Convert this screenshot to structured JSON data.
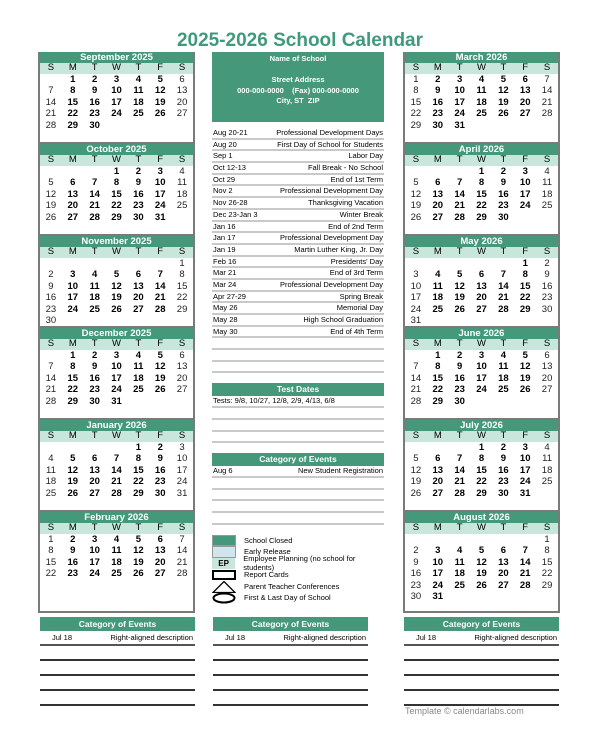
{
  "title": "2025-2026 School Calendar",
  "dow": [
    "S",
    "M",
    "T",
    "W",
    "T",
    "F",
    "S"
  ],
  "months_left": [
    {
      "name": "September 2025",
      "weeks": [
        [
          "",
          "1",
          "2",
          "3",
          "4",
          "5",
          "6"
        ],
        [
          "7",
          "8",
          "9",
          "10",
          "11",
          "12",
          "13"
        ],
        [
          "14",
          "15",
          "16",
          "17",
          "18",
          "19",
          "20"
        ],
        [
          "21",
          "22",
          "23",
          "24",
          "25",
          "26",
          "27"
        ],
        [
          "28",
          "29",
          "30",
          "",
          "",
          "",
          ""
        ]
      ]
    },
    {
      "name": "October 2025",
      "weeks": [
        [
          "",
          "",
          "",
          "1",
          "2",
          "3",
          "4"
        ],
        [
          "5",
          "6",
          "7",
          "8",
          "9",
          "10",
          "11"
        ],
        [
          "12",
          "13",
          "14",
          "15",
          "16",
          "17",
          "18"
        ],
        [
          "19",
          "20",
          "21",
          "22",
          "23",
          "24",
          "25"
        ],
        [
          "26",
          "27",
          "28",
          "29",
          "30",
          "31",
          ""
        ]
      ]
    },
    {
      "name": "November 2025",
      "weeks": [
        [
          "",
          "",
          "",
          "",
          "",
          "",
          "1"
        ],
        [
          "2",
          "3",
          "4",
          "5",
          "6",
          "7",
          "8"
        ],
        [
          "9",
          "10",
          "11",
          "12",
          "13",
          "14",
          "15"
        ],
        [
          "16",
          "17",
          "18",
          "19",
          "20",
          "21",
          "22"
        ],
        [
          "23",
          "24",
          "25",
          "26",
          "27",
          "28",
          "29"
        ],
        [
          "30",
          "",
          "",
          "",
          "",
          "",
          ""
        ]
      ]
    },
    {
      "name": "December 2025",
      "weeks": [
        [
          "",
          "1",
          "2",
          "3",
          "4",
          "5",
          "6"
        ],
        [
          "7",
          "8",
          "9",
          "10",
          "11",
          "12",
          "13"
        ],
        [
          "14",
          "15",
          "16",
          "17",
          "18",
          "19",
          "20"
        ],
        [
          "21",
          "22",
          "23",
          "24",
          "25",
          "26",
          "27"
        ],
        [
          "28",
          "29",
          "30",
          "31",
          "",
          "",
          ""
        ]
      ]
    },
    {
      "name": "January 2026",
      "weeks": [
        [
          "",
          "",
          "",
          "",
          "1",
          "2",
          "3"
        ],
        [
          "4",
          "5",
          "6",
          "7",
          "8",
          "9",
          "10"
        ],
        [
          "11",
          "12",
          "13",
          "14",
          "15",
          "16",
          "17"
        ],
        [
          "18",
          "19",
          "20",
          "21",
          "22",
          "23",
          "24"
        ],
        [
          "25",
          "26",
          "27",
          "28",
          "29",
          "30",
          "31"
        ]
      ]
    },
    {
      "name": "February 2026",
      "weeks": [
        [
          "1",
          "2",
          "3",
          "4",
          "5",
          "6",
          "7"
        ],
        [
          "8",
          "9",
          "10",
          "11",
          "12",
          "13",
          "14"
        ],
        [
          "15",
          "16",
          "17",
          "18",
          "19",
          "20",
          "21"
        ],
        [
          "22",
          "23",
          "24",
          "25",
          "26",
          "27",
          "28"
        ]
      ]
    }
  ],
  "months_right": [
    {
      "name": "March 2026",
      "weeks": [
        [
          "1",
          "2",
          "3",
          "4",
          "5",
          "6",
          "7"
        ],
        [
          "8",
          "9",
          "10",
          "11",
          "12",
          "13",
          "14"
        ],
        [
          "15",
          "16",
          "17",
          "18",
          "19",
          "20",
          "21"
        ],
        [
          "22",
          "23",
          "24",
          "25",
          "26",
          "27",
          "28"
        ],
        [
          "29",
          "30",
          "31",
          "",
          "",
          "",
          ""
        ]
      ]
    },
    {
      "name": "April 2026",
      "weeks": [
        [
          "",
          "",
          "",
          "1",
          "2",
          "3",
          "4"
        ],
        [
          "5",
          "6",
          "7",
          "8",
          "9",
          "10",
          "11"
        ],
        [
          "12",
          "13",
          "14",
          "15",
          "16",
          "17",
          "18"
        ],
        [
          "19",
          "20",
          "21",
          "22",
          "23",
          "24",
          "25"
        ],
        [
          "26",
          "27",
          "28",
          "29",
          "30",
          "",
          ""
        ]
      ]
    },
    {
      "name": "May 2026",
      "weeks": [
        [
          "",
          "",
          "",
          "",
          "",
          "1",
          "2"
        ],
        [
          "3",
          "4",
          "5",
          "6",
          "7",
          "8",
          "9"
        ],
        [
          "10",
          "11",
          "12",
          "13",
          "14",
          "15",
          "16"
        ],
        [
          "17",
          "18",
          "19",
          "20",
          "21",
          "22",
          "23"
        ],
        [
          "24",
          "25",
          "26",
          "27",
          "28",
          "29",
          "30"
        ],
        [
          "31",
          "",
          "",
          "",
          "",
          "",
          ""
        ]
      ]
    },
    {
      "name": "June 2026",
      "weeks": [
        [
          "",
          "1",
          "2",
          "3",
          "4",
          "5",
          "6"
        ],
        [
          "7",
          "8",
          "9",
          "10",
          "11",
          "12",
          "13"
        ],
        [
          "14",
          "15",
          "16",
          "17",
          "18",
          "19",
          "20"
        ],
        [
          "21",
          "22",
          "23",
          "24",
          "25",
          "26",
          "27"
        ],
        [
          "28",
          "29",
          "30",
          "",
          "",
          "",
          ""
        ]
      ]
    },
    {
      "name": "July 2026",
      "weeks": [
        [
          "",
          "",
          "",
          "1",
          "2",
          "3",
          "4"
        ],
        [
          "5",
          "6",
          "7",
          "8",
          "9",
          "10",
          "11"
        ],
        [
          "12",
          "13",
          "14",
          "15",
          "16",
          "17",
          "18"
        ],
        [
          "19",
          "20",
          "21",
          "22",
          "23",
          "24",
          "25"
        ],
        [
          "26",
          "27",
          "28",
          "29",
          "30",
          "31",
          ""
        ]
      ]
    },
    {
      "name": "August 2026",
      "weeks": [
        [
          "",
          "",
          "",
          "",
          "",
          "",
          "1"
        ],
        [
          "2",
          "3",
          "4",
          "5",
          "6",
          "7",
          "8"
        ],
        [
          "9",
          "10",
          "11",
          "12",
          "13",
          "14",
          "15"
        ],
        [
          "16",
          "17",
          "18",
          "19",
          "20",
          "21",
          "22"
        ],
        [
          "23",
          "24",
          "25",
          "26",
          "27",
          "28",
          "29"
        ],
        [
          "30",
          "31",
          "",
          "",
          "",
          "",
          ""
        ]
      ]
    }
  ],
  "school": {
    "name": "Name of School",
    "street": "Street Address",
    "phone": "000-000-0000",
    "fax": "(Fax) 000-000-0000",
    "city": "City, ST  ZIP"
  },
  "events": [
    {
      "date": "Aug 20-21",
      "title": "Professional Development Days"
    },
    {
      "date": "Aug 20",
      "title": "First Day of School for Students"
    },
    {
      "date": "Sep 1",
      "title": "Labor Day"
    },
    {
      "date": "Oct 12-13",
      "title": "Fall Break - No School"
    },
    {
      "date": "Oct 29",
      "title": "End of 1st Term"
    },
    {
      "date": "Nov 2",
      "title": "Professional Development Day"
    },
    {
      "date": "Nov 26-28",
      "title": "Thanksgiving Vacation"
    },
    {
      "date": "Dec 23-Jan 3",
      "title": "Winter Break"
    },
    {
      "date": "Jan 16",
      "title": "End of 2nd Term"
    },
    {
      "date": "Jan 17",
      "title": "Professional Development Day"
    },
    {
      "date": "Jan 19",
      "title": "Martin Luther King, Jr. Day"
    },
    {
      "date": "Feb 16",
      "title": "Presidents' Day"
    },
    {
      "date": "Mar 21",
      "title": "End of 3rd Term"
    },
    {
      "date": "Mar 24",
      "title": "Professional Development Day"
    },
    {
      "date": "Apr 27-29",
      "title": "Spring Break"
    },
    {
      "date": "May 26",
      "title": "Memorial Day"
    },
    {
      "date": "May 28",
      "title": "High School Graduation"
    },
    {
      "date": "May 30",
      "title": "End of 4th Term"
    }
  ],
  "test_dates": {
    "heading": "Test Dates",
    "text": "Tests: 9/8, 10/27, 12/8, 2/9, 4/13, 6/8"
  },
  "category_center": {
    "heading": "Category of Events",
    "rows": [
      {
        "date": "Aug 6",
        "title": "New Student Registration"
      }
    ]
  },
  "legend": [
    {
      "icon": "school-closed-swatch",
      "label": "School Closed"
    },
    {
      "icon": "early-release-swatch",
      "label": "Early Release"
    },
    {
      "icon": "ep-swatch",
      "badge": "EP",
      "label": "Employee Planning (no school for students)"
    },
    {
      "icon": "rectangle-outline-icon",
      "label": "Report Cards"
    },
    {
      "icon": "triangle-outline-icon",
      "label": "Parent Teacher Conferences"
    },
    {
      "icon": "ellipse-outline-icon",
      "label": "First & Last Day of School"
    }
  ],
  "bottom_categories": [
    {
      "heading": "Category of Events",
      "date": "Jul 18",
      "title": "Right-aligned description"
    },
    {
      "heading": "Category of Events",
      "date": "Jul 18",
      "title": "Right-aligned description"
    },
    {
      "heading": "Category of Events",
      "date": "Jul 18",
      "title": "Right-aligned description"
    }
  ],
  "footer": "Template © calendarlabs.com",
  "colors": {
    "accent": "#45987a",
    "title": "#3f9a7c",
    "dow_bg": "#c8e6dc"
  }
}
